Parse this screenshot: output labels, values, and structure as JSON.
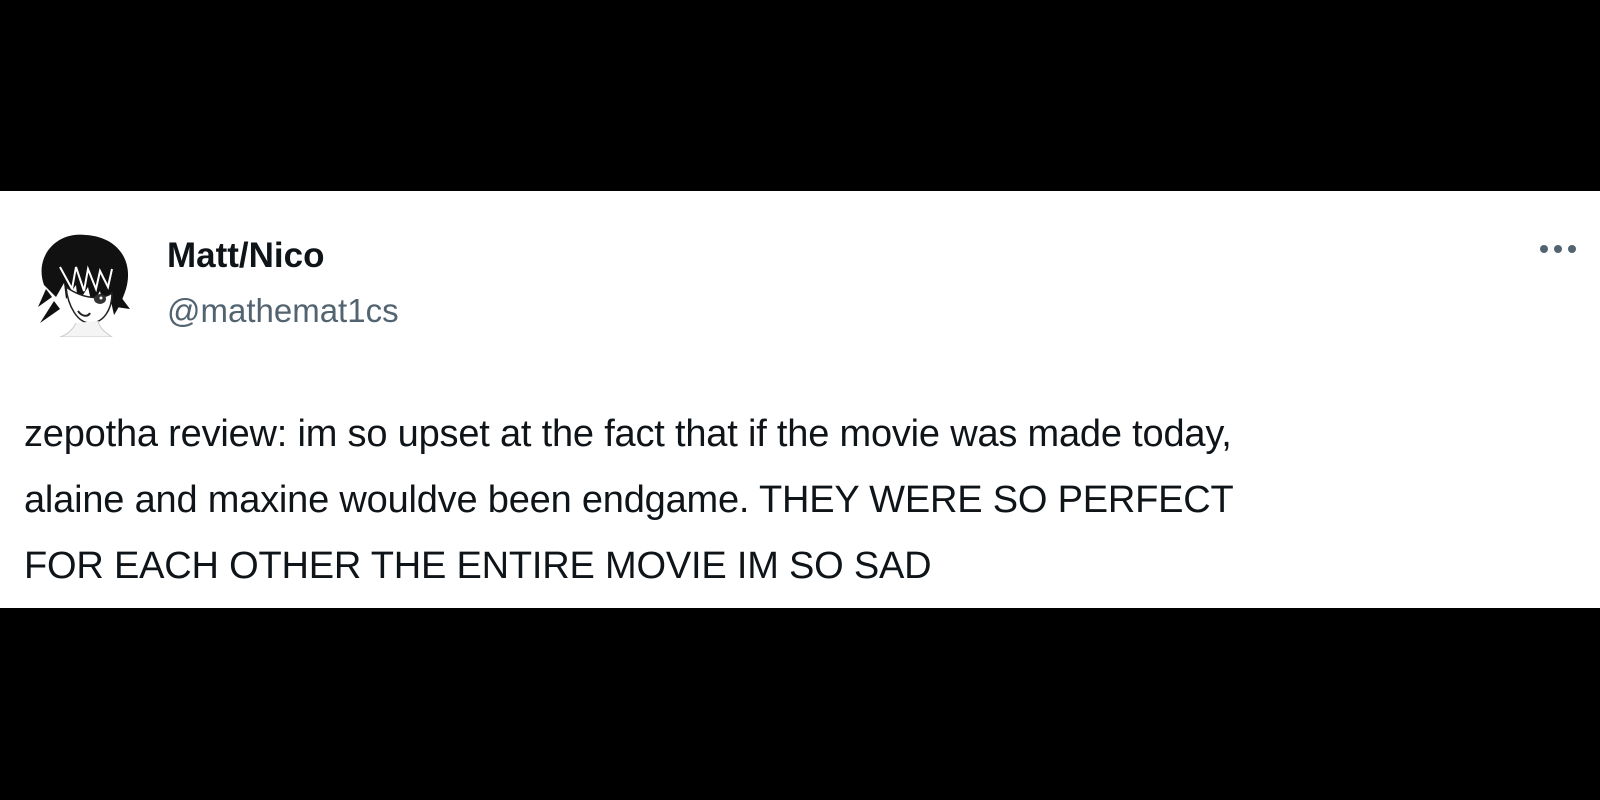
{
  "tweet": {
    "display_name": "Matt/Nico",
    "handle": "@mathemat1cs",
    "avatar_icon": "anime-character-avatar-icon",
    "more_icon": "more-options-icon",
    "text_lines": [
      "zepotha review: im so upset at the fact that if the movie was made today,",
      "alaine and maxine wouldve been endgame. THEY WERE SO PERFECT",
      "FOR EACH OTHER THE ENTIRE MOVIE IM SO SAD"
    ]
  },
  "colors": {
    "background": "#000000",
    "card": "#ffffff",
    "text": "#0f1419",
    "secondary_text": "#536471"
  }
}
